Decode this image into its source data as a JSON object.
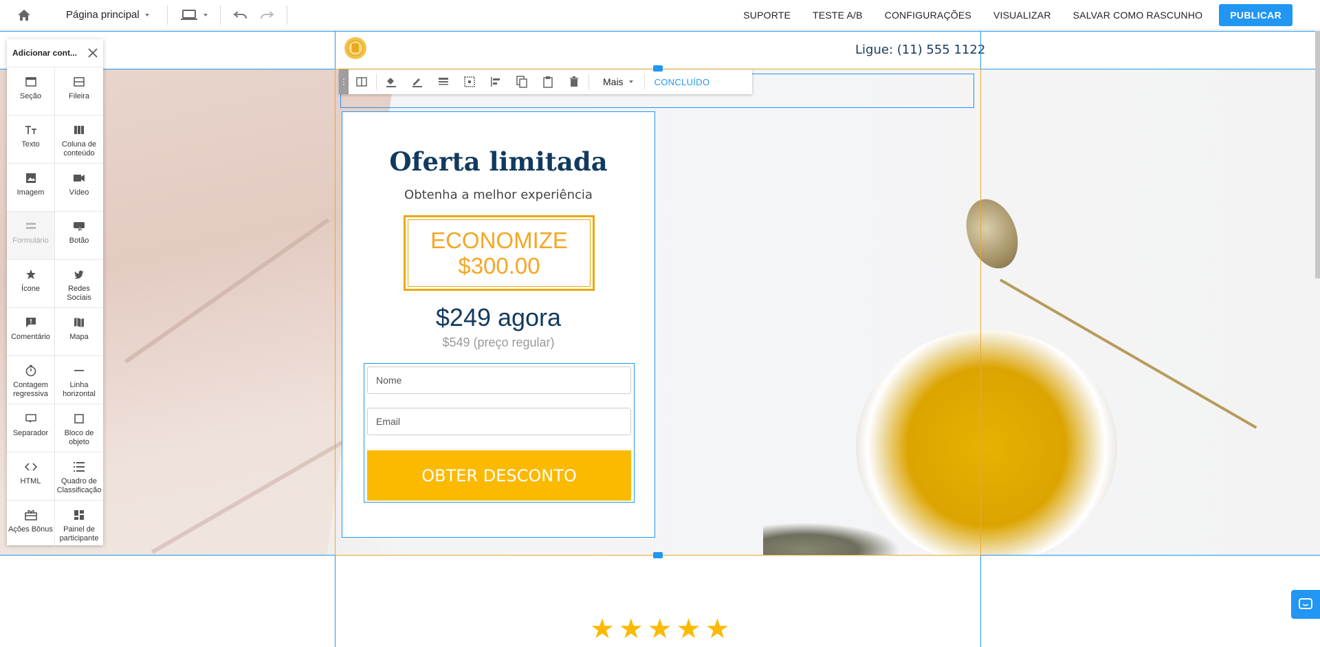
{
  "topbar": {
    "page_selector": "Página principal",
    "links": [
      "SUPORTE",
      "TESTE A/B",
      "CONFIGURAÇÕES",
      "VISUALIZAR",
      "SALVAR COMO RASCUNHO"
    ],
    "publish": "PUBLICAR"
  },
  "header": {
    "phone": "Ligue: (11) 555 1122"
  },
  "element_toolbar": {
    "more": "Mais",
    "done": "CONCLUÍDO"
  },
  "offer": {
    "title": "Oferta limitada",
    "subtitle": "Obtenha a melhor experiência",
    "save_line1": "ECONOMIZE",
    "save_line2": "$300.00",
    "price_now": "$249 agora",
    "price_regular": "$549 (preço regular)",
    "name_placeholder": "Nome",
    "email_placeholder": "Email",
    "cta": "OBTER DESCONTO"
  },
  "rating": {
    "stars": 5
  },
  "panel": {
    "title": "Adicionar cont...",
    "items": [
      {
        "label": "Seção",
        "icon": "section-icon"
      },
      {
        "label": "Fileira",
        "icon": "row-icon"
      },
      {
        "label": "Texto",
        "icon": "text-icon"
      },
      {
        "label": "Coluna de conteúdo",
        "icon": "columns-icon"
      },
      {
        "label": "Imagem",
        "icon": "image-icon"
      },
      {
        "label": "Vídeo",
        "icon": "video-icon"
      },
      {
        "label": "Formulário",
        "icon": "form-icon"
      },
      {
        "label": "Botão",
        "icon": "button-icon"
      },
      {
        "label": "Ícone",
        "icon": "star-icon"
      },
      {
        "label": "Redes Sociais",
        "icon": "twitter-icon"
      },
      {
        "label": "Comentário",
        "icon": "comment-icon"
      },
      {
        "label": "Mapa",
        "icon": "map-icon"
      },
      {
        "label": "Contagem regressiva",
        "icon": "timer-icon"
      },
      {
        "label": "Linha horizontal",
        "icon": "hr-icon"
      },
      {
        "label": "Separador",
        "icon": "separator-icon"
      },
      {
        "label": "Bloco de objeto",
        "icon": "box-icon"
      },
      {
        "label": "HTML",
        "icon": "code-icon"
      },
      {
        "label": "Quadro de Classificação",
        "icon": "leaderboard-icon"
      },
      {
        "label": "Ações Bônus",
        "icon": "gift-icon"
      },
      {
        "label": "Painel de participante",
        "icon": "dashboard-icon"
      }
    ]
  },
  "colors": {
    "accent": "#2196f3",
    "cta": "#fbb900",
    "title": "#123a5e",
    "save": "#f5a623"
  }
}
